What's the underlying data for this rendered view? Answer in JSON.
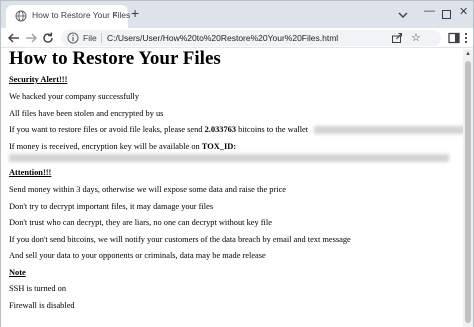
{
  "browser": {
    "tab_title": "How to Restore Your Files",
    "tab_close": "×",
    "new_tab": "+",
    "window_min": "—",
    "window_close": "✕",
    "scheme_label": "File",
    "url": "C:/Users/User/How%20to%20Restore%20Your%20Files.html",
    "star": "☆"
  },
  "page": {
    "title": "How to Restore Your Files",
    "security_heading": "Security Alert!!!",
    "lines": [
      "We hacked your company successfully",
      "All files have been stolen and encrypted by us"
    ],
    "restore_prefix": "If you want to restore files or avoid file leaks, please send ",
    "btc_amount": "2.033763",
    "restore_suffix": " bitcoins to the wallet",
    "key_prefix": "If money is received, encryption key will be available on ",
    "tox_label": "TOX_ID:",
    "attention_heading": "Attention!!!",
    "attention_lines": [
      "Send money within 3 days, otherwise we will expose some data and raise the price",
      "Don't try to decrypt important files, it may damage your files",
      "Don't trust who can decrypt, they are liars, no one can decrypt without key file",
      "If you don't send bitcoins, we will notify your customers of the data breach by email and text message",
      "And sell your data to your opponents or criminals, data may be made release"
    ],
    "note_heading": "Note",
    "note_lines": [
      "SSH is turned on",
      "Firewall is disabled"
    ]
  }
}
